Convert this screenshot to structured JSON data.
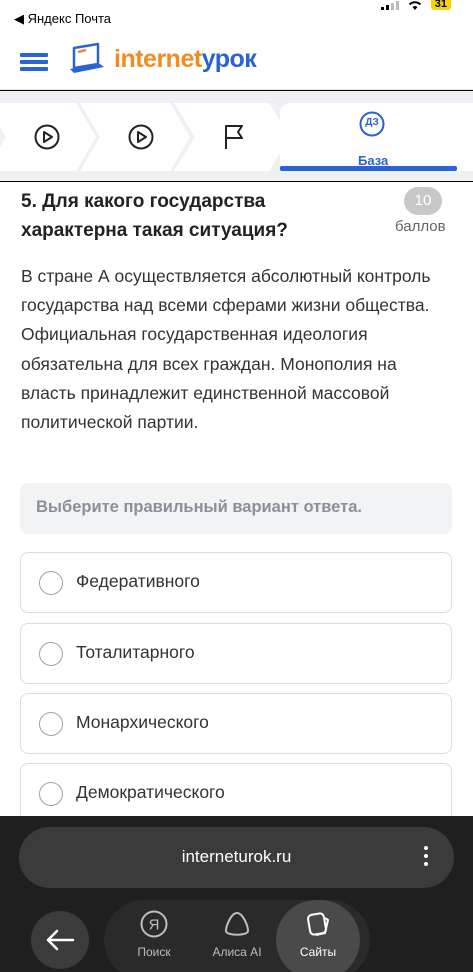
{
  "status_bar": {
    "back_app": "◀ Яндекс Почта",
    "battery": "31"
  },
  "header": {
    "logo_part1": "internet",
    "logo_part2": "урок"
  },
  "tabs": [
    {
      "name": "play"
    },
    {
      "name": "play-outline"
    },
    {
      "name": "flag"
    },
    {
      "name": "hw",
      "badge": "ДЗ",
      "label": "База"
    }
  ],
  "question": {
    "title": "5. Для какого государства характерна такая ситуация?",
    "score": "10",
    "score_unit": "баллов",
    "text": "В стране А осуществляется абсолютный контроль государства над всеми сферами жизни общества. Официальная государственная идеология обязательна для всех граждан. Монополия на власть принадлежит единственной массовой политической партии.",
    "hint": "Выберите правильный вариант ответа.",
    "options": [
      "Федеративного",
      "Тоталитарного",
      "Монархического",
      "Демократического"
    ]
  },
  "browser": {
    "url": "interneturok.ru",
    "nav": [
      {
        "label": "Поиск"
      },
      {
        "label": "Алиса AI"
      },
      {
        "label": "Сайты"
      }
    ]
  },
  "colors": {
    "brand_blue": "#2a63d4",
    "brand_orange": "#f28c1e"
  }
}
